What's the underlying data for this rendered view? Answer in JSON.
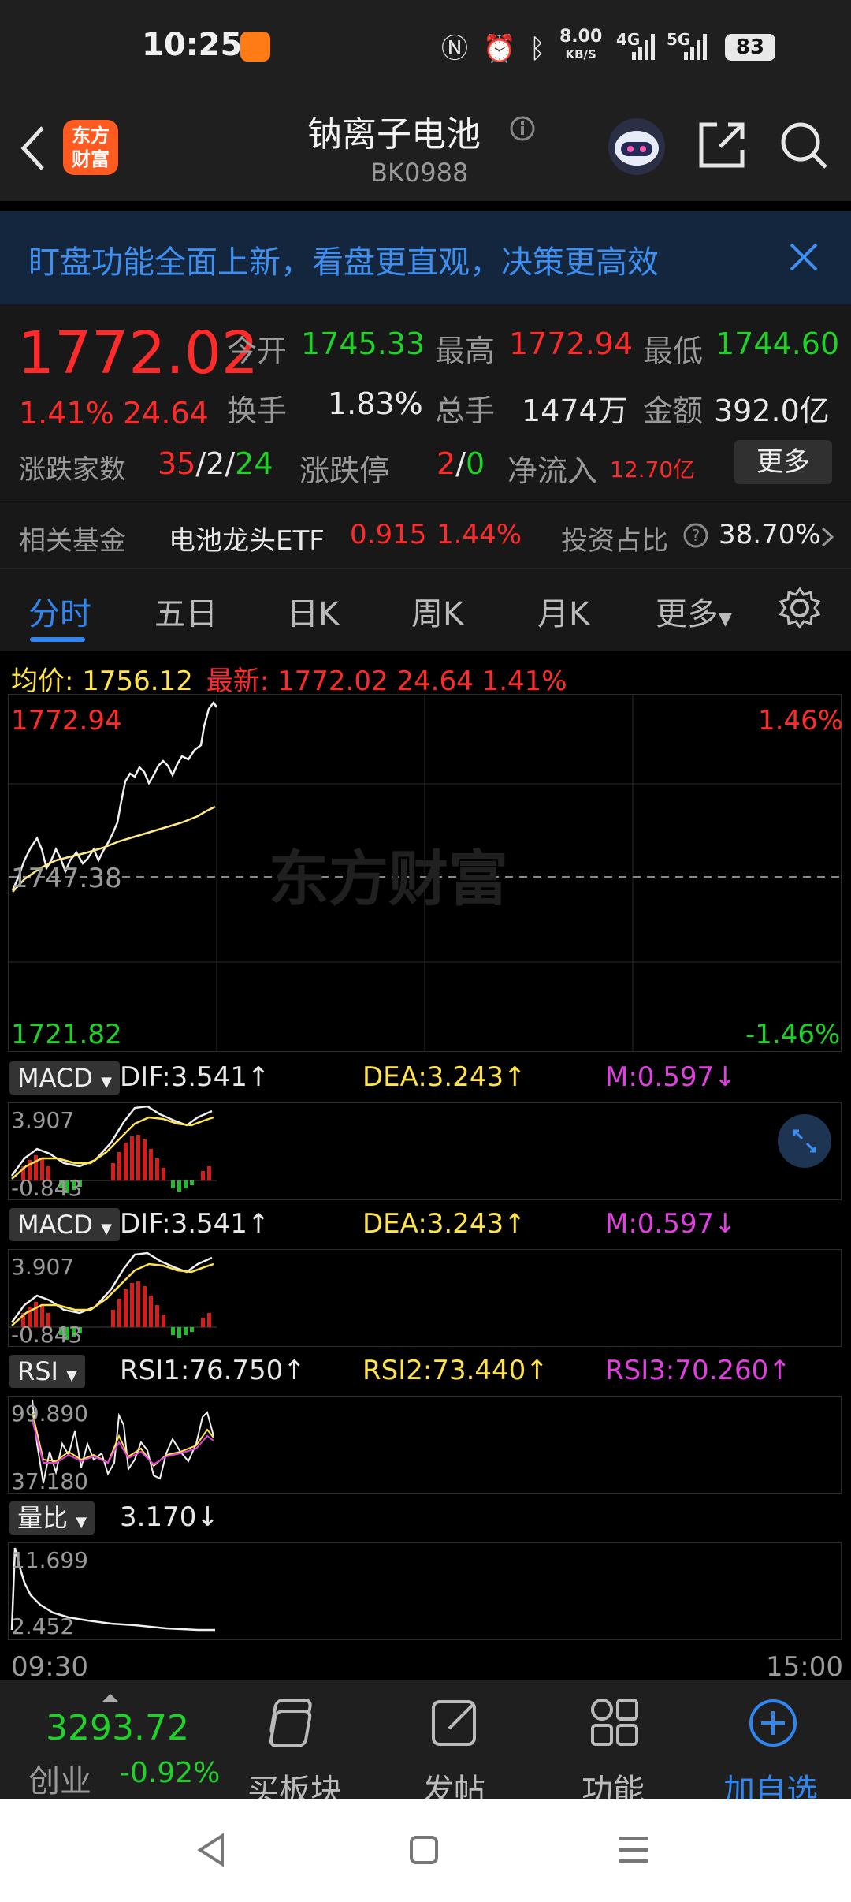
{
  "status_bar": {
    "time": "10:25",
    "net_speed": "8.00",
    "net_unit": "KB/S",
    "net_4g": "4G",
    "net_5g": "5G",
    "battery": "83"
  },
  "header": {
    "logo_text_1": "东方",
    "logo_text_2": "财富",
    "title": "钠离子电池",
    "code": "BK0988"
  },
  "banner": {
    "text": "盯盘功能全面上新，看盘更直观，决策更高效"
  },
  "quote": {
    "price": "1772.02",
    "change_pct": "1.41%",
    "change": "24.64",
    "open_label": "今开",
    "open": "1745.33",
    "high_label": "最高",
    "high": "1772.94",
    "low_label": "最低",
    "low": "1744.60",
    "turnover_label": "换手",
    "turnover": "1.83%",
    "volume_label": "总手",
    "volume": "1474万",
    "amount_label": "金额",
    "amount": "392.0亿",
    "breadth_label": "涨跌家数",
    "up_count": "35",
    "flat_count": "2",
    "down_count": "24",
    "sep": "/",
    "limit_label": "涨跌停",
    "limit_up": "2",
    "limit_down": "0",
    "netflow_label": "净流入",
    "netflow": "12.70亿",
    "more_button": "更多"
  },
  "fund": {
    "label": "相关基金",
    "name": "电池龙头ETF",
    "price": "0.915",
    "pct": "1.44%",
    "ratio_label": "投资占比",
    "ratio": "38.70%"
  },
  "tabs": [
    "分时",
    "五日",
    "日K",
    "周K",
    "月K",
    "更多"
  ],
  "info_line": {
    "avg_label": "均价:",
    "avg": "1756.12",
    "latest_label": "最新:",
    "latest": "1772.02",
    "change": "24.64",
    "pct": "1.41%"
  },
  "main_chart": {
    "top_price": "1772.94",
    "mid_price": "1747.38",
    "bottom_price": "1721.82",
    "top_pct": "1.46%",
    "bottom_pct": "-1.46%",
    "watermark": "东方财富",
    "time_start": "09:30",
    "time_end": "15:00"
  },
  "macd1": {
    "label": "MACD",
    "dif": "DIF:3.541↑",
    "dea": "DEA:3.243↑",
    "m": "M:0.597↓",
    "top": "3.907",
    "bottom": "-0.843"
  },
  "macd2": {
    "label": "MACD",
    "dif": "DIF:3.541↑",
    "dea": "DEA:3.243↑",
    "m": "M:0.597↓",
    "top": "3.907",
    "bottom": "-0.843"
  },
  "rsi": {
    "label": "RSI",
    "rsi1": "RSI1:76.750↑",
    "rsi2": "RSI2:73.440↑",
    "rsi3": "RSI3:70.260↑",
    "top": "99.890",
    "bottom": "37.180"
  },
  "volratio": {
    "label": "量比",
    "value": "3.170↓",
    "top": "11.699",
    "bottom": "2.452"
  },
  "bottom_nav": {
    "index_value": "3293.72",
    "index_name": "创业",
    "index_pct": "-0.92%",
    "items": [
      "买板块",
      "发帖",
      "功能",
      "加自选"
    ]
  },
  "colors": {
    "up": "#ff2b2b",
    "down": "#1fd129",
    "accent": "#2f86f2"
  }
}
